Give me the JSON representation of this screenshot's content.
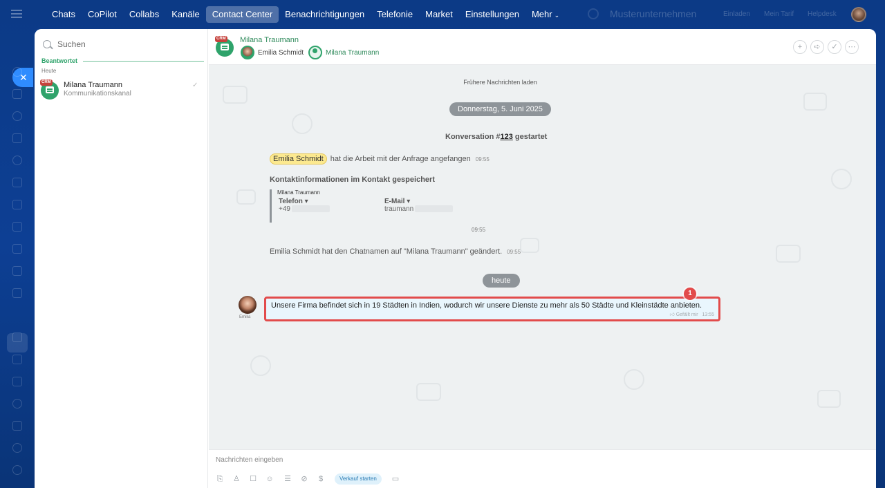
{
  "nav": {
    "items": [
      "Chats",
      "CoPilot",
      "Collabs",
      "Kanäle",
      "Contact Center",
      "Benachrichtigungen",
      "Telefonie",
      "Market",
      "Einstellungen"
    ],
    "more": "Mehr",
    "active": "Contact Center",
    "company": "Musterunternehmen",
    "invite": "Einladen",
    "plan": "Mein Tarif",
    "helpdesk": "Helpdesk"
  },
  "sidebar": {
    "search_placeholder": "Suchen",
    "section_title": "Beantwortet",
    "section_sub": "Heute",
    "conversation": {
      "name": "Milana Traumann",
      "subtitle": "Kommunikationskanal",
      "badge": "CRM"
    }
  },
  "chat": {
    "title": "Milana Traumann",
    "badge": "CRM",
    "participants": [
      "Emilia Schmidt",
      "Milana Traumann"
    ],
    "load_more": "Frühere Nachrichten laden",
    "date_label": "Donnerstag, 5. Juni 2025",
    "conv_start_prefix": "Konversation #",
    "conv_number": "123",
    "conv_start_suffix": " gestartet",
    "started_name": "Emilia Schmidt",
    "started_text": "hat die Arbeit mit der Anfrage angefangen",
    "started_time": "09:55",
    "kinfo_title": "Kontaktinformationen im Kontakt gespeichert",
    "kinfo_name": "Milana Traumann",
    "phone_label": "Telefon",
    "phone_value": "+49",
    "email_label": "E-Mail",
    "email_value": "traumann",
    "kinfo_time": "09:55",
    "rename_text": "Emilia Schmidt hat den Chatnamen auf \"Milana Traumann\" geändert.",
    "rename_time": "09:55",
    "today_label": "heute",
    "message": {
      "author": "Emilia",
      "text": "Unsere Firma befindet sich in 19 Städten in Indien, wodurch wir unsere Dienste zu mehr als 50 Städte und Kleinstädte anbieten.",
      "like": "Gefällt mir",
      "time": "13:55"
    },
    "step_badge": "1"
  },
  "composer": {
    "placeholder": "Nachrichten eingeben",
    "sale_button": "Verkauf starten"
  },
  "colors": {
    "nav_bg": "#0d3f94",
    "accent_green": "#2fa36b",
    "highlight_red": "#e24b4b",
    "message_bg": "#e9f6fd"
  }
}
